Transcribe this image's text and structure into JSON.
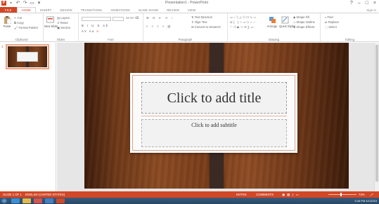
{
  "window": {
    "title": "Presentation1 - PowerPoint",
    "controls": [
      "?",
      "–",
      "□",
      "×"
    ]
  },
  "quick_access": {
    "app_logo": "P",
    "icons": [
      "save-icon",
      "undo-icon",
      "redo-icon",
      "start-from-beginning-icon",
      "customize-icon"
    ]
  },
  "tabs": [
    "FILE",
    "HOME",
    "INSERT",
    "DESIGN",
    "TRANSITIONS",
    "ANIMATIONS",
    "SLIDE SHOW",
    "REVIEW",
    "VIEW"
  ],
  "active_tab": "HOME",
  "account": "Sign in",
  "ribbon": {
    "clipboard": {
      "label": "Clipboard",
      "paste": "Paste",
      "cut": "Cut",
      "copy": "Copy",
      "format_painter": "Format Painter"
    },
    "slides": {
      "label": "Slides",
      "new_slide": "New Slide",
      "layout": "Layout",
      "reset": "Reset",
      "section": "Section"
    },
    "font": {
      "label": "Font"
    },
    "paragraph": {
      "label": "Paragraph",
      "text_direction": "Text Direction",
      "align_text": "Align Text",
      "convert_smartart": "Convert to SmartArt"
    },
    "drawing": {
      "label": "Drawing",
      "arrange": "Arrange",
      "quick_styles": "Quick Styles",
      "shape_fill": "Shape Fill",
      "shape_outline": "Shape Outline",
      "shape_effects": "Shape Effects"
    },
    "editing": {
      "label": "Editing",
      "find": "Find",
      "replace": "Replace",
      "select": "Select"
    }
  },
  "thumbnails": [
    {
      "number": "1"
    }
  ],
  "slide": {
    "title_placeholder": "Click to add title",
    "subtitle_placeholder": "Click to add subtitle"
  },
  "statusbar": {
    "slide_info": "SLIDE 1 OF 1",
    "language": "ENGLISH (UNITED STATES)",
    "notes": "NOTES",
    "comments": "COMMENTS",
    "zoom": "74%"
  },
  "taskbar": {
    "clock": "3:45 PM",
    "date": "4/1/2015"
  },
  "colors": {
    "accent": "#d24726",
    "wood_dark": "#3d1c0a",
    "wood_mid": "#8a4a22",
    "band": "#3b2a23",
    "taskbar": "#274866"
  }
}
